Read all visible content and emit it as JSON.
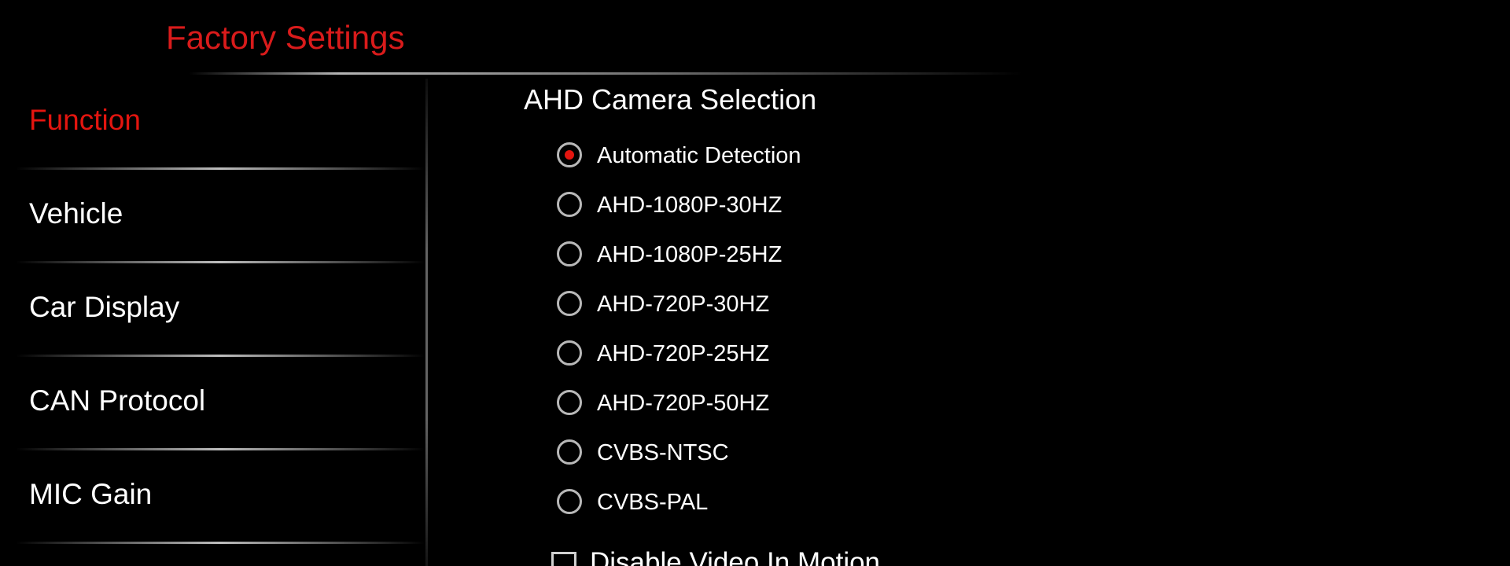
{
  "header": {
    "title": "Factory Settings"
  },
  "sidebar": {
    "items": [
      {
        "label": "Function",
        "active": true
      },
      {
        "label": "Vehicle",
        "active": false
      },
      {
        "label": "Car Display",
        "active": false
      },
      {
        "label": "CAN Protocol",
        "active": false
      },
      {
        "label": "MIC Gain",
        "active": false
      }
    ]
  },
  "main": {
    "section_title": "AHD Camera Selection",
    "options": [
      {
        "label": "Automatic Detection",
        "selected": true
      },
      {
        "label": "AHD-1080P-30HZ",
        "selected": false
      },
      {
        "label": "AHD-1080P-25HZ",
        "selected": false
      },
      {
        "label": "AHD-720P-30HZ",
        "selected": false
      },
      {
        "label": "AHD-720P-25HZ",
        "selected": false
      },
      {
        "label": "AHD-720P-50HZ",
        "selected": false
      },
      {
        "label": "CVBS-NTSC",
        "selected": false
      },
      {
        "label": "CVBS-PAL",
        "selected": false
      }
    ],
    "checkbox": {
      "label": "Disable Video In Motion",
      "checked": false
    }
  },
  "colors": {
    "accent": "#e3150f",
    "title": "#d91b1b",
    "background": "#000000",
    "text": "#ffffff"
  }
}
